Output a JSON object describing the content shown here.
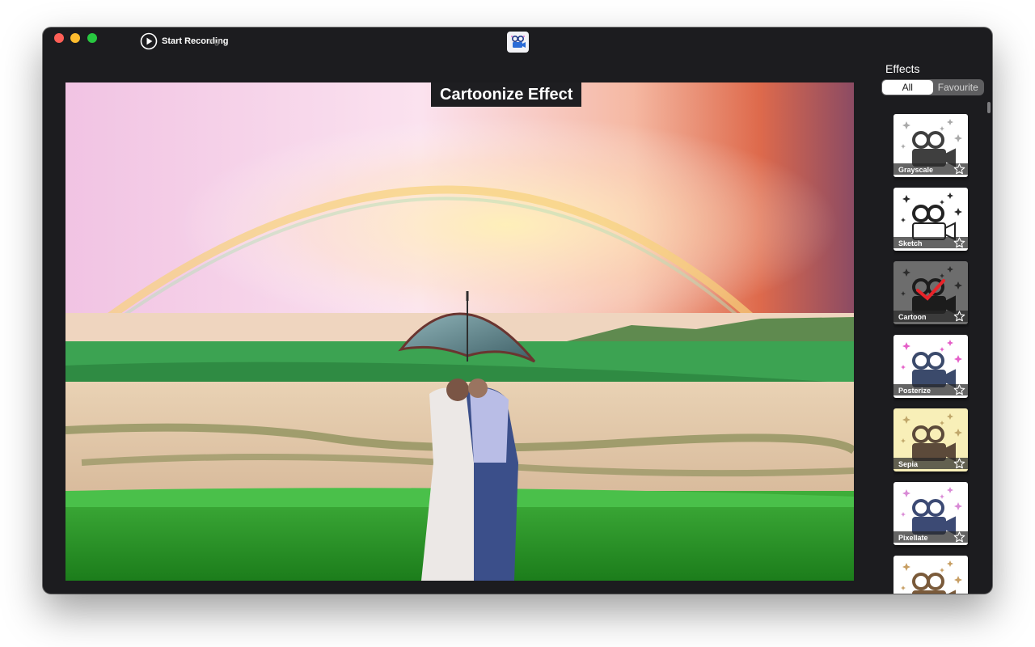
{
  "toolbar": {
    "record_label": "Start Recording",
    "record_ghost": "ng",
    "record_icon": "play-circle-icon",
    "app_icon": "camera-app-icon"
  },
  "preview": {
    "effect_title": "Cartoonize Effect",
    "scene_description_icon": "photo-preview"
  },
  "sidebar": {
    "heading": "Effects",
    "tabs": [
      {
        "label": "All",
        "selected": true
      },
      {
        "label": "Favourite",
        "selected": false
      }
    ],
    "effects": [
      {
        "label": "Grayscale",
        "favorite_icon": "star-outline-icon",
        "selected": false,
        "bg": "#ffffff",
        "camera": "#3f3f3f",
        "sparkle": "#a9a9a9"
      },
      {
        "label": "Sketch",
        "favorite_icon": "star-outline-icon",
        "selected": false,
        "bg": "#ffffff",
        "camera": "#ffffff",
        "sparkle": "#2a2a2a"
      },
      {
        "label": "Cartoon",
        "favorite_icon": "star-outline-icon",
        "selected": true,
        "bg": "#6d6d6d",
        "camera": "#1c1c1c",
        "sparkle": "#2c2c2c"
      },
      {
        "label": "Posterize",
        "favorite_icon": "star-outline-icon",
        "selected": false,
        "bg": "#ffffff",
        "camera": "#3b4a6b",
        "sparkle": "#e55fc8"
      },
      {
        "label": "Sepia",
        "favorite_icon": "star-outline-icon",
        "selected": false,
        "bg": "#f8efb8",
        "camera": "#5c4a3a",
        "sparkle": "#c0a76a"
      },
      {
        "label": "Pixellate",
        "favorite_icon": "star-outline-icon",
        "selected": false,
        "bg": "#ffffff",
        "camera": "#3c4a74",
        "sparkle": "#d98ad6"
      },
      {
        "label": "",
        "favorite_icon": "star-outline-icon",
        "selected": false,
        "bg": "#ffffff",
        "camera": "#7a5a3a",
        "sparkle": "#c79e63"
      }
    ]
  },
  "colors": {
    "window_bg": "#1c1c1f",
    "selected_check": "#e8242a"
  }
}
